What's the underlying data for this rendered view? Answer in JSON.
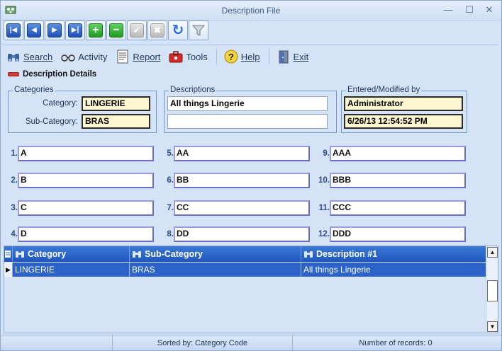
{
  "window": {
    "title": "Description File",
    "minimize": "—",
    "maximize": "☐",
    "close": "✕"
  },
  "navbar": {
    "buttons": [
      {
        "name": "first-record-icon",
        "glyph": "|◀"
      },
      {
        "name": "previous-record-icon",
        "glyph": "◀"
      },
      {
        "name": "next-record-icon",
        "glyph": "▶"
      },
      {
        "name": "last-record-icon",
        "glyph": "▶|"
      },
      {
        "name": "add-record-icon",
        "glyph": "+"
      },
      {
        "name": "delete-record-icon",
        "glyph": "−"
      },
      {
        "name": "save-check-icon",
        "glyph": "✔"
      },
      {
        "name": "cancel-x-icon",
        "glyph": "✖"
      },
      {
        "name": "refresh-icon",
        "glyph": "↻"
      },
      {
        "name": "filter-icon",
        "glyph": "▼"
      }
    ]
  },
  "menu": {
    "search": "Search",
    "activity": "Activity",
    "report": "Report",
    "tools": "Tools",
    "help": "Help",
    "exit": "Exit"
  },
  "section": {
    "title": "Description Details"
  },
  "categories": {
    "group_label": "Categories",
    "category_label": "Category:",
    "category_value": "LINGERIE",
    "subcategory_label": "Sub-Category:",
    "subcategory_value": "BRAS"
  },
  "descriptions": {
    "group_label": "Descriptions",
    "line1": "All things Lingerie",
    "line2": ""
  },
  "entered": {
    "group_label": "Entered/Modified by",
    "user": "Administrator",
    "timestamp": "6/26/13 12:54:52 PM"
  },
  "numbered": [
    {
      "num": "1.",
      "value": "A"
    },
    {
      "num": "2.",
      "value": "B"
    },
    {
      "num": "3.",
      "value": "C"
    },
    {
      "num": "4.",
      "value": "D"
    },
    {
      "num": "5.",
      "value": "AA"
    },
    {
      "num": "6.",
      "value": "BB"
    },
    {
      "num": "7.",
      "value": "CC"
    },
    {
      "num": "8.",
      "value": "DD"
    },
    {
      "num": "9.",
      "value": "AAA"
    },
    {
      "num": "10.",
      "value": "BBB"
    },
    {
      "num": "11.",
      "value": "CCC"
    },
    {
      "num": "12.",
      "value": "DDD"
    }
  ],
  "grid": {
    "columns": [
      "Category",
      "Sub-Category",
      "Description #1"
    ],
    "rows": [
      {
        "category": "LINGERIE",
        "subcategory": "BRAS",
        "description": "All things Lingerie"
      }
    ]
  },
  "status": {
    "sorted_by": "Sorted by: Category Code",
    "record_count": "Number of records: 0"
  },
  "colors": {
    "grid_header": "#2057bd",
    "selected_row": "#2c63c9",
    "readonly_field": "#fff7cf",
    "window_bg": "#d4e3f6"
  }
}
